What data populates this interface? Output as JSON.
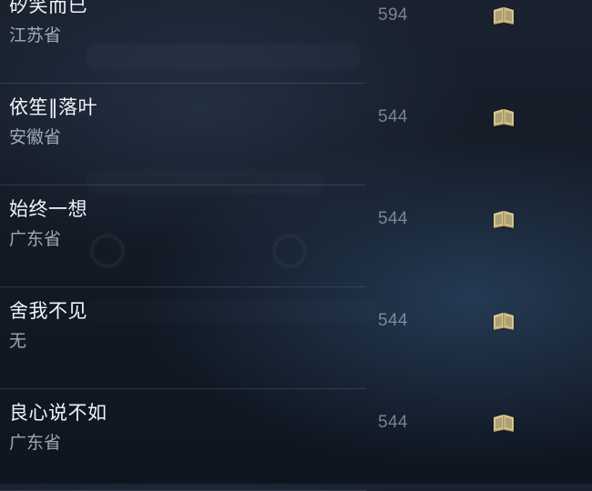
{
  "rows": [
    {
      "name": "矽笑而已",
      "region": "江苏省",
      "score": "594",
      "badge_icon": "book-badge-icon"
    },
    {
      "name": "依笙‖落叶",
      "region": "安徽省",
      "score": "544",
      "badge_icon": "book-badge-icon"
    },
    {
      "name": "始终一想",
      "region": "广东省",
      "score": "544",
      "badge_icon": "book-badge-icon"
    },
    {
      "name": "舍我不见",
      "region": "无",
      "score": "544",
      "badge_icon": "book-badge-icon"
    },
    {
      "name": "良心说不如",
      "region": "广东省",
      "score": "544",
      "badge_icon": "book-badge-icon"
    }
  ],
  "colors": {
    "gold": "#D9C58C",
    "gold_dark": "#B39C61"
  }
}
